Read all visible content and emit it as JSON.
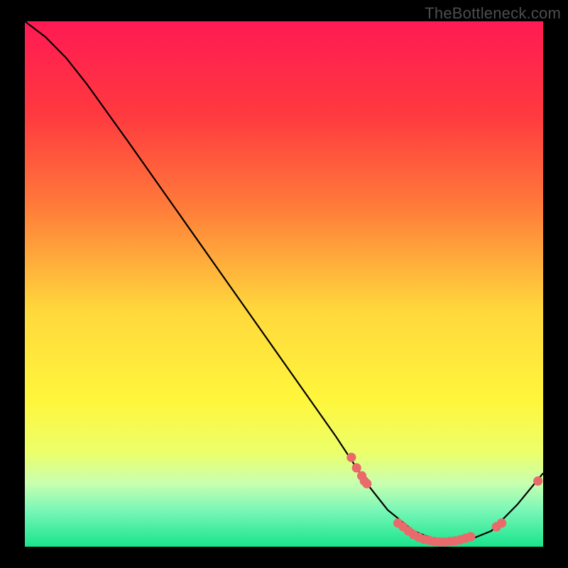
{
  "watermark": "TheBottleneck.com",
  "chart_data": {
    "type": "line",
    "title": "",
    "xlabel": "",
    "ylabel": "",
    "xlim": [
      0,
      100
    ],
    "ylim": [
      0,
      100
    ],
    "gradient_stops": [
      {
        "offset": 0,
        "color": "#ff1a53"
      },
      {
        "offset": 18,
        "color": "#ff3a3f"
      },
      {
        "offset": 35,
        "color": "#ff7a3a"
      },
      {
        "offset": 55,
        "color": "#ffd83c"
      },
      {
        "offset": 72,
        "color": "#fff63c"
      },
      {
        "offset": 82,
        "color": "#ecff6a"
      },
      {
        "offset": 88,
        "color": "#c8ffb0"
      },
      {
        "offset": 93,
        "color": "#7af7b7"
      },
      {
        "offset": 100,
        "color": "#19e48d"
      }
    ],
    "curve": [
      {
        "x": 0,
        "y": 100
      },
      {
        "x": 4,
        "y": 97
      },
      {
        "x": 8,
        "y": 93
      },
      {
        "x": 12,
        "y": 88
      },
      {
        "x": 20,
        "y": 77
      },
      {
        "x": 30,
        "y": 63
      },
      {
        "x": 40,
        "y": 49
      },
      {
        "x": 50,
        "y": 35
      },
      {
        "x": 60,
        "y": 21
      },
      {
        "x": 66,
        "y": 12
      },
      {
        "x": 70,
        "y": 7
      },
      {
        "x": 75,
        "y": 3
      },
      {
        "x": 80,
        "y": 1
      },
      {
        "x": 85,
        "y": 1
      },
      {
        "x": 90,
        "y": 3
      },
      {
        "x": 95,
        "y": 8
      },
      {
        "x": 100,
        "y": 14
      }
    ],
    "markers": [
      {
        "x": 63,
        "y": 17
      },
      {
        "x": 64,
        "y": 15
      },
      {
        "x": 65,
        "y": 13.5
      },
      {
        "x": 65.5,
        "y": 12.5
      },
      {
        "x": 66,
        "y": 12
      },
      {
        "x": 72,
        "y": 4.5
      },
      {
        "x": 73,
        "y": 3.8
      },
      {
        "x": 74,
        "y": 3.0
      },
      {
        "x": 75,
        "y": 2.3
      },
      {
        "x": 76,
        "y": 1.8
      },
      {
        "x": 77,
        "y": 1.4
      },
      {
        "x": 78,
        "y": 1.2
      },
      {
        "x": 79,
        "y": 1.0
      },
      {
        "x": 80,
        "y": 0.9
      },
      {
        "x": 81,
        "y": 0.9
      },
      {
        "x": 82,
        "y": 1.0
      },
      {
        "x": 83,
        "y": 1.1
      },
      {
        "x": 84,
        "y": 1.3
      },
      {
        "x": 85,
        "y": 1.6
      },
      {
        "x": 86,
        "y": 1.9
      },
      {
        "x": 91,
        "y": 3.8
      },
      {
        "x": 92,
        "y": 4.5
      },
      {
        "x": 99,
        "y": 12.5
      }
    ],
    "marker_color": "#e96a6a",
    "marker_radius_pct": 0.9
  }
}
